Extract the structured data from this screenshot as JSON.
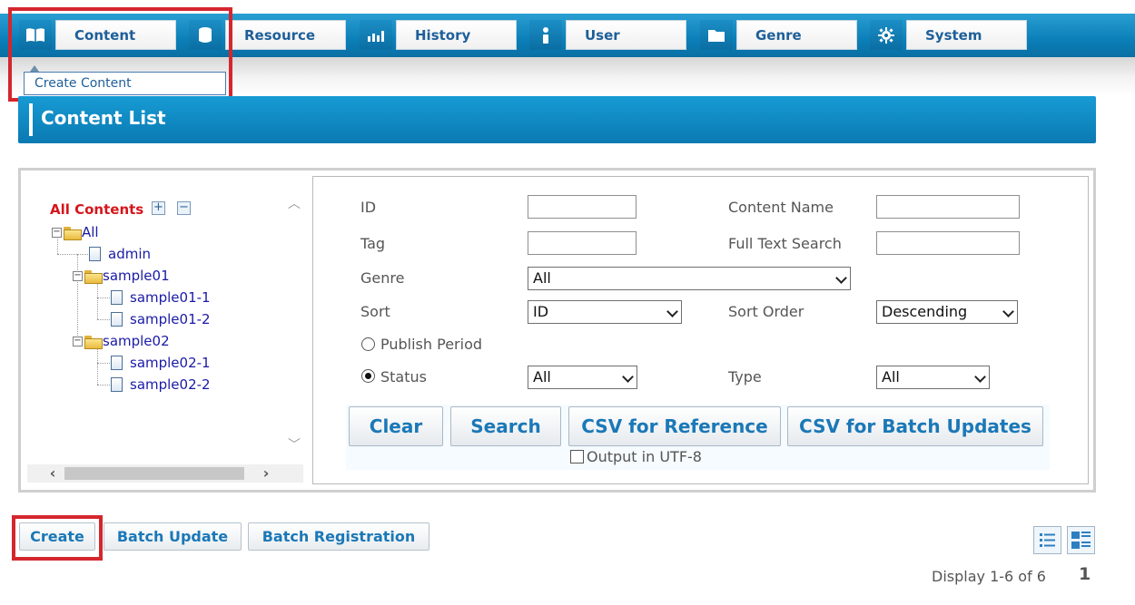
{
  "nav": {
    "items": [
      {
        "label": "Content",
        "icon": "book-icon"
      },
      {
        "label": "Resource",
        "icon": "database-icon"
      },
      {
        "label": "History",
        "icon": "bar-chart-icon"
      },
      {
        "label": "User",
        "icon": "user-icon"
      },
      {
        "label": "Genre",
        "icon": "folder-icon"
      },
      {
        "label": "System",
        "icon": "gear-icon"
      }
    ],
    "dropdown_item": "Create Content"
  },
  "header": {
    "title": "Content List"
  },
  "tree": {
    "title": "All Contents",
    "nodes": [
      "All",
      "admin",
      "sample01",
      "sample01-1",
      "sample01-2",
      "sample02",
      "sample02-1",
      "sample02-2"
    ]
  },
  "form": {
    "id_label": "ID",
    "content_name_label": "Content Name",
    "tag_label": "Tag",
    "full_text_label": "Full Text Search",
    "genre_label": "Genre",
    "genre_value": "All",
    "sort_label": "Sort",
    "sort_value": "ID",
    "sort_order_label": "Sort Order",
    "sort_order_value": "Descending",
    "publish_period_label": "Publish Period",
    "status_label": "Status",
    "status_value": "All",
    "type_label": "Type",
    "type_value": "All",
    "clear": "Clear",
    "search": "Search",
    "csv_reference": "CSV for Reference",
    "csv_batch": "CSV for Batch Updates",
    "utf8_label": "Output in UTF-8"
  },
  "actions": {
    "create": "Create",
    "batch_update": "Batch Update",
    "batch_registration": "Batch Registration"
  },
  "pagination": {
    "display_text": "Display 1-6 of 6",
    "page": "1"
  },
  "colors": {
    "accent": "#0b7fb8",
    "highlight": "#d5262e",
    "link": "#1a1aa6"
  }
}
